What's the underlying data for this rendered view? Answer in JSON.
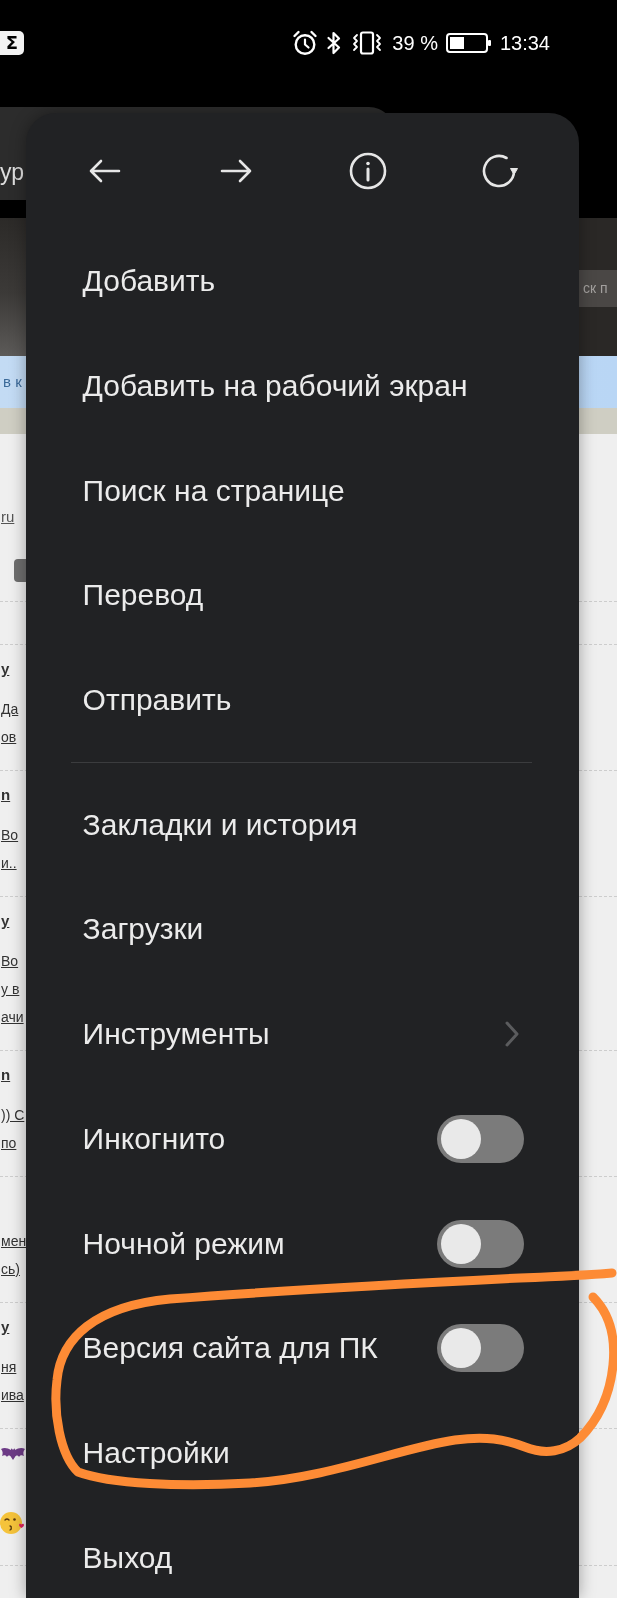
{
  "status_bar": {
    "app_icon": "Σ",
    "battery": "39 %",
    "time": "13:34"
  },
  "browser": {
    "address": "ур",
    "search": {
      "placeholder": "ск п"
    },
    "notice": "в к"
  },
  "page": {
    "link": "ru",
    "threads": [
      {
        "kind": "comment",
        "author": "y",
        "lines": [
          "Да",
          "ов"
        ]
      },
      {
        "kind": "comment",
        "author": "n",
        "lines": [
          "Во",
          "и.."
        ]
      },
      {
        "kind": "comment",
        "author": "y",
        "lines": [
          "Во",
          "у в",
          "ачи"
        ]
      },
      {
        "kind": "comment",
        "author": "n",
        "lines": [
          ")) С",
          "по"
        ]
      },
      {
        "kind": "comment",
        "lines": [
          "мен",
          "сь)"
        ]
      },
      {
        "kind": "comment",
        "author": "y",
        "lines": [
          "ня",
          "ива"
        ]
      },
      {
        "kind": "emoji"
      }
    ]
  },
  "menu": {
    "sections": [
      {
        "items": [
          {
            "kind": "action",
            "label": "Добавить"
          },
          {
            "kind": "action",
            "label": "Добавить на рабочий экран"
          },
          {
            "kind": "action",
            "label": "Поиск на странице"
          },
          {
            "kind": "action",
            "label": "Перевод"
          },
          {
            "kind": "action",
            "label": "Отправить"
          }
        ]
      },
      {
        "items": [
          {
            "kind": "action",
            "label": "Закладки и история"
          },
          {
            "kind": "action",
            "label": "Загрузки"
          },
          {
            "kind": "submenu",
            "label": "Инструменты"
          },
          {
            "kind": "toggle",
            "label": "Инкогнито",
            "on": false
          },
          {
            "kind": "toggle",
            "label": "Ночной режим",
            "on": false
          },
          {
            "kind": "toggle",
            "label": "Версия сайта для ПК",
            "on": false
          },
          {
            "kind": "action",
            "label": "Настройки"
          },
          {
            "kind": "action",
            "label": "Выход"
          }
        ]
      }
    ]
  }
}
